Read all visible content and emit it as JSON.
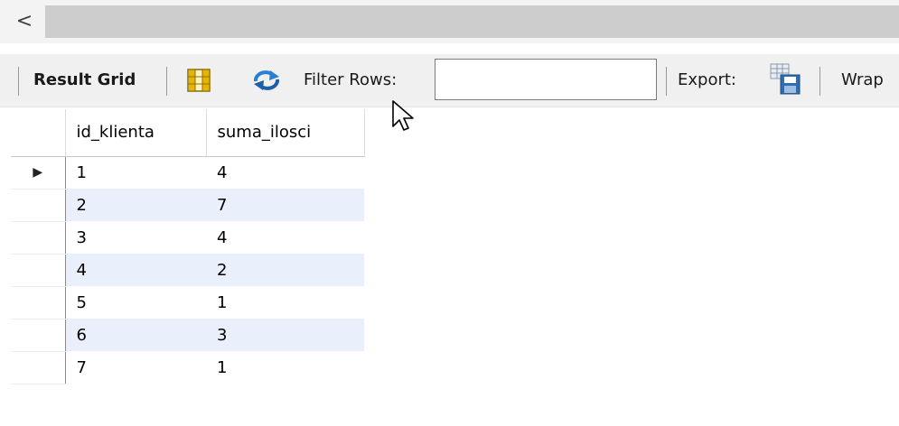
{
  "scrollbar": {
    "left_arrow": "<"
  },
  "toolbar": {
    "result_grid_label": "Result Grid",
    "filter_rows_label": "Filter Rows:",
    "filter_value": "",
    "export_label": "Export:",
    "wrap_label": "Wrap"
  },
  "grid": {
    "columns": [
      "id_klienta",
      "suma_ilosci"
    ],
    "current_row_marker": "▶",
    "rows": [
      [
        "1",
        "4"
      ],
      [
        "2",
        "7"
      ],
      [
        "3",
        "4"
      ],
      [
        "4",
        "2"
      ],
      [
        "5",
        "1"
      ],
      [
        "6",
        "3"
      ],
      [
        "7",
        "1"
      ]
    ]
  },
  "colors": {
    "alt_row": "#eaf0fb",
    "grid_icon": "#e8b400",
    "refresh_icon": "#2a7fd4"
  }
}
